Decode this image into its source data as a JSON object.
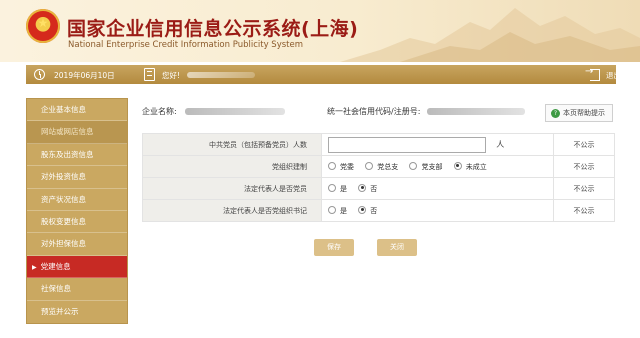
{
  "header": {
    "emblem_glyph": "★",
    "title_cn": "国家企业信用信息公示系统(上海)",
    "title_en": "National Enterprise Credit Information Publicity System"
  },
  "infobar": {
    "date": "2019年06月10日",
    "greeting": "您好!",
    "logout": "退出登录"
  },
  "sidebar": {
    "items": [
      {
        "label": "企业基本信息"
      },
      {
        "label": "网站或网店信息"
      },
      {
        "label": "股东及出资信息"
      },
      {
        "label": "对外投资信息"
      },
      {
        "label": "资产状况信息"
      },
      {
        "label": "股权变更信息"
      },
      {
        "label": "对外担保信息"
      },
      {
        "label": "党建信息",
        "arrow": "▶"
      },
      {
        "label": "社保信息"
      },
      {
        "label": "预览并公示"
      }
    ]
  },
  "main": {
    "company_label": "企业名称:",
    "code_label": "统一社会信用代码/注册号:",
    "help_label": "本页帮助提示",
    "help_icon_glyph": "?",
    "form": {
      "row1_label": "中共党员（包括预备党员）人数",
      "row1_unit": "人",
      "row2_label": "党组织建制",
      "row2_options": [
        "党委",
        "党总支",
        "党支部",
        "未成立"
      ],
      "row3_label": "法定代表人是否党员",
      "row4_label": "法定代表人是否党组织书记",
      "yes": "是",
      "no": "否",
      "not_public": "不公示"
    },
    "save_label": "保存",
    "close_label": "关闭"
  },
  "colors": {
    "brand_red": "#9b1c16",
    "gold": "#caa861",
    "active_red": "#c72a24",
    "button_gold": "#dcc088"
  }
}
